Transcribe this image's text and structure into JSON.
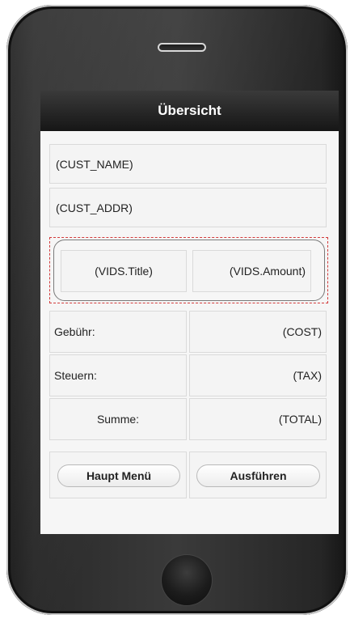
{
  "header": {
    "title": "Übersicht"
  },
  "customer": {
    "name": "(CUST_NAME)",
    "address": "(CUST_ADDR)"
  },
  "vids": {
    "title": "(VIDS.Title)",
    "amount": "(VIDS.Amount)"
  },
  "summary": {
    "fee_label": "Gebühr:",
    "fee_value": "(COST)",
    "tax_label": "Steuern:",
    "tax_value": "(TAX)",
    "total_label": "Summe:",
    "total_value": "(TOTAL)"
  },
  "buttons": {
    "main_menu": "Haupt Menü",
    "execute": "Ausführen"
  }
}
